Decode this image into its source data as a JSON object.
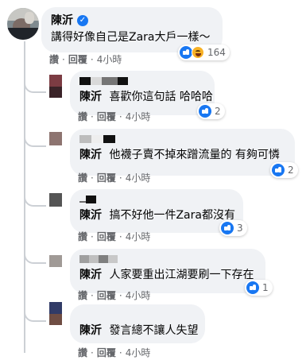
{
  "main_comment": {
    "author": "陳沂",
    "verified_icon": "verified-badge-icon",
    "text": "講得好像自己是Zara大戶一樣～",
    "reaction_count": "164",
    "actions": {
      "like": "讚",
      "reply": "回覆",
      "time": "4小時"
    }
  },
  "replies": [
    {
      "author": "陳沂",
      "text": "喜歡你這句話 哈哈哈",
      "reaction_count": "2",
      "actions": {
        "like": "讚",
        "reply": "回覆",
        "time": "4小時"
      }
    },
    {
      "author": "陳沂",
      "text": "他襪子賣不掉來蹭流量的 有夠可憐",
      "reaction_count": "2",
      "actions": {
        "like": "讚",
        "reply": "回覆",
        "time": "4小時"
      }
    },
    {
      "author": "陳沂",
      "text": "搞不好他一件Zara都沒有",
      "reaction_count": "3",
      "actions": {
        "like": "讚",
        "reply": "回覆",
        "time": "4小時"
      }
    },
    {
      "author": "陳沂",
      "text": "人家要重出江湖要刷一下存在",
      "reaction_count": "1",
      "actions": {
        "like": "讚",
        "reply": "回覆",
        "time": "4小時"
      }
    },
    {
      "author": "陳沂",
      "text": "發言總不讓人失望",
      "reaction_count": "",
      "actions": {
        "like": "讚",
        "reply": "回覆",
        "time": "4小時"
      }
    }
  ],
  "colors": {
    "accent": "#1877f2",
    "bubble": "#f0f2f5",
    "muted_text": "#65676b",
    "thread_line": "#ccd0d5"
  }
}
